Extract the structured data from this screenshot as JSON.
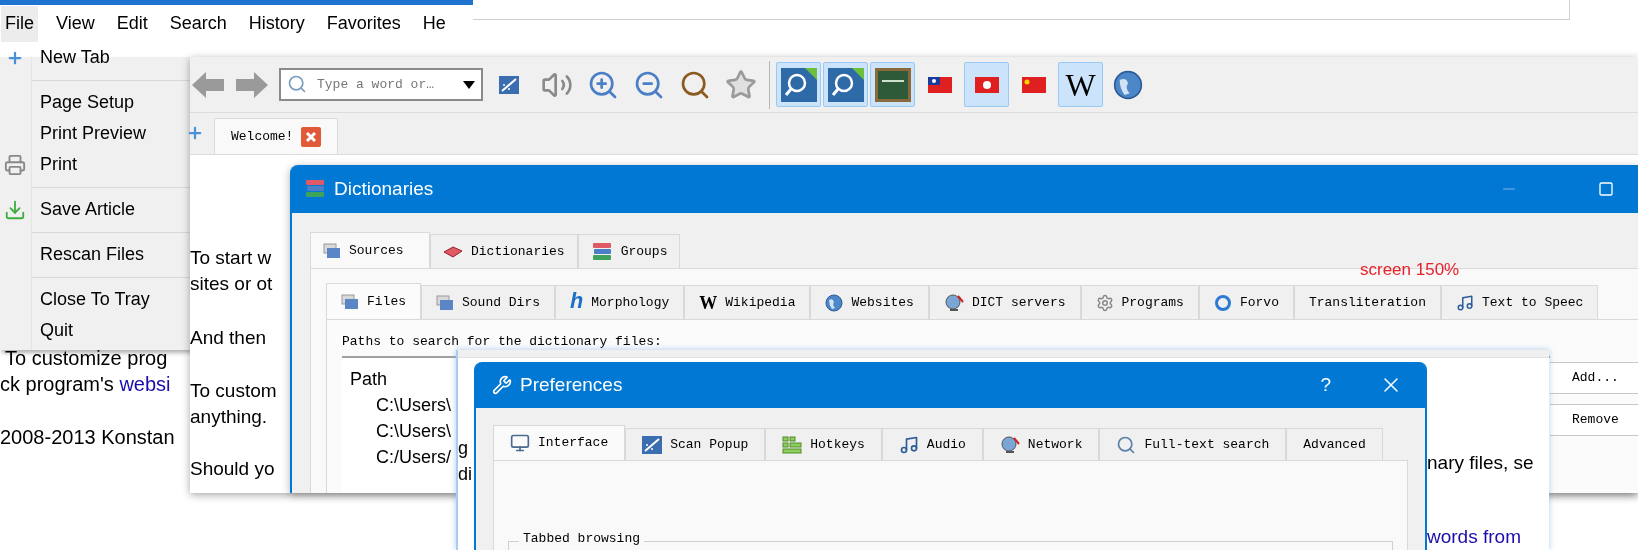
{
  "main_window": {
    "menu_bar": [
      {
        "label": "File",
        "selected": true
      },
      {
        "label": "View",
        "selected": false
      },
      {
        "label": "Edit",
        "selected": false
      },
      {
        "label": "Search",
        "selected": false
      },
      {
        "label": "History",
        "selected": false
      },
      {
        "label": "Favorites",
        "selected": false
      },
      {
        "label": "He",
        "selected": false
      }
    ],
    "file_menu": [
      {
        "label": "New Tab",
        "separator_after": true
      },
      {
        "label": "Page Setup",
        "separator_after": false
      },
      {
        "label": "Print Preview",
        "separator_after": false
      },
      {
        "label": "Print",
        "separator_after": true
      },
      {
        "label": "Save Article",
        "separator_after": true
      },
      {
        "label": "Rescan Files",
        "separator_after": true
      },
      {
        "label": "Close To Tray",
        "separator_after": false
      },
      {
        "label": "Quit",
        "separator_after": false
      }
    ],
    "page_lines": [
      {
        "text": "To customize prog"
      },
      {
        "text": "ck program's ",
        "link": "websi"
      },
      {
        "text": "2008-2013 Konstan"
      }
    ]
  },
  "browser_window": {
    "search": {
      "placeholder": "Type a word or…"
    },
    "dictionary_buttons": [
      {
        "kind": "lookup",
        "selected": true
      },
      {
        "kind": "lookup",
        "selected": true
      },
      {
        "kind": "board",
        "selected": true
      },
      {
        "kind": "flag_tw",
        "selected": false
      },
      {
        "kind": "flag_hk",
        "selected": true
      },
      {
        "kind": "flag_cn",
        "selected": false
      },
      {
        "kind": "wiki",
        "label": "W",
        "selected": true
      },
      {
        "kind": "globe",
        "selected": false
      }
    ],
    "tab": {
      "label": "Welcome!"
    },
    "content_lines": [
      "To start w",
      "sites or ot",
      "And then",
      "To custom",
      "anything.",
      "Should yo"
    ]
  },
  "dictionaries_window": {
    "title": "Dictionaries",
    "tabs": [
      {
        "label": "Sources",
        "selected": true
      },
      {
        "label": "Dictionaries",
        "selected": false
      },
      {
        "label": "Groups",
        "selected": false
      }
    ],
    "subtabs": [
      {
        "label": "Files",
        "selected": true
      },
      {
        "label": "Sound Dirs",
        "selected": false
      },
      {
        "label": "Morphology",
        "badge": "h",
        "selected": false
      },
      {
        "label": "Wikipedia",
        "badge": "W",
        "selected": false
      },
      {
        "label": "Websites",
        "selected": false
      },
      {
        "label": "DICT servers",
        "selected": false
      },
      {
        "label": "Programs",
        "selected": false
      },
      {
        "label": "Forvo",
        "selected": false
      },
      {
        "label": "Transliteration",
        "selected": false
      },
      {
        "label": "Text to Speec",
        "selected": false
      }
    ],
    "annotation": "screen 150%",
    "paths_label": "Paths to search for the dictionary files:",
    "path_list": {
      "header": "Path",
      "rows": [
        "C:\\Users\\",
        "C:\\Users\\",
        "C:/Users/"
      ]
    },
    "buttons": [
      "Add...",
      "Remove"
    ]
  },
  "article_window": {
    "left_lines": [
      "g",
      "di"
    ],
    "right_lines": [
      {
        "text": "nary files, se",
        "link": false
      },
      {
        "text": "words from",
        "link": true
      }
    ]
  },
  "preferences_window": {
    "title": "Preferences",
    "help": "?",
    "tabs": [
      {
        "label": "Interface",
        "selected": true
      },
      {
        "label": "Scan Popup",
        "selected": false
      },
      {
        "label": "Hotkeys",
        "selected": false
      },
      {
        "label": "Audio",
        "selected": false
      },
      {
        "label": "Network",
        "selected": false
      },
      {
        "label": "Full-text search",
        "selected": false
      },
      {
        "label": "Advanced",
        "selected": false
      }
    ],
    "group_title": "Tabbed browsing"
  }
}
